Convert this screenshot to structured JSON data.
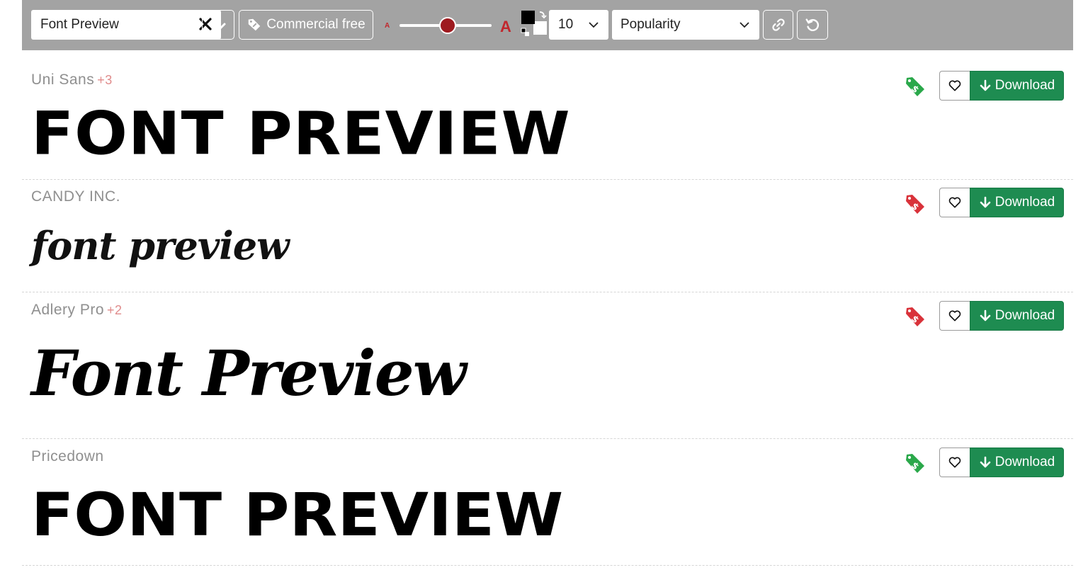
{
  "toolbar": {
    "search": {
      "value": "Font Preview"
    },
    "commercial_label": "Commercial free",
    "size_small_label": "A",
    "size_big_label": "A",
    "size_slider_fraction": 0.45,
    "count_value": "10",
    "sort_value": "Popularity",
    "accent_color": "#c1272d"
  },
  "fonts": [
    {
      "name": "Uni Sans",
      "extra": "+3",
      "preview": "FONT PREVIEW",
      "license_color": "#2aa84a",
      "download_label": "Download"
    },
    {
      "name": "CANDY INC.",
      "extra": "",
      "preview": "font preview",
      "license_color": "#d9323a",
      "download_label": "Download"
    },
    {
      "name": "Adlery Pro",
      "extra": "+2",
      "preview": "Font Preview",
      "license_color": "#d9323a",
      "download_label": "Download"
    },
    {
      "name": "Pricedown",
      "extra": "",
      "preview": "FONT PREVIEW",
      "license_color": "#2aa84a",
      "download_label": "Download"
    }
  ]
}
